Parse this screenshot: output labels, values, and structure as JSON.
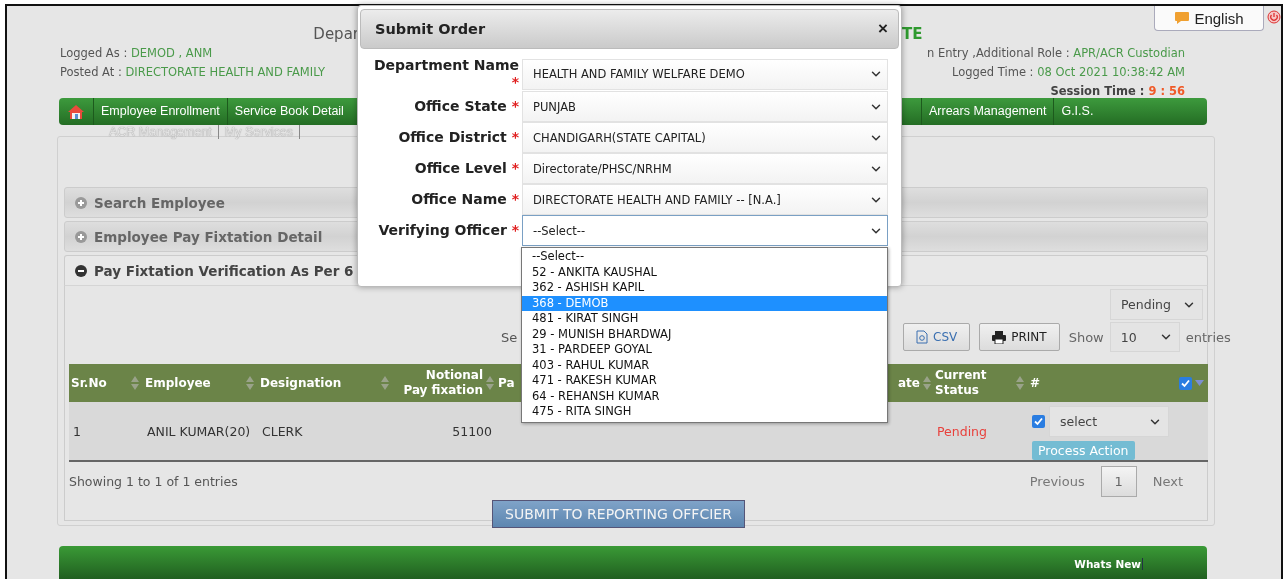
{
  "header": {
    "title_left": "Depar",
    "title_right": "TE",
    "language": "English",
    "left_lines": [
      {
        "label": "Logged As :",
        "value": "DEMOD , ANM"
      },
      {
        "label": "Posted At :",
        "value": "DIRECTORATE HEALTH AND FAMILY"
      }
    ],
    "right_lines": [
      {
        "label": "n Entry ,Additional Role :",
        "value": "APR/ACR Custodian",
        "kind": "info"
      },
      {
        "label": "Logged Time :",
        "value": "08 Oct 2021 10:38:42 AM",
        "kind": "info"
      },
      {
        "label": "Session Time :",
        "value": "9 : 56",
        "kind": "alert"
      }
    ]
  },
  "nav": {
    "left_items": [
      "Employee Enrollment",
      "Service Book Detail"
    ],
    "right_items": [
      "Arrears Management",
      "G.I.S."
    ],
    "sub_items": [
      "ACR Management",
      "My Services"
    ]
  },
  "sections": [
    {
      "title": "Search Employee",
      "expanded": false
    },
    {
      "title": "Employee Pay Fixtation Detail",
      "expanded": false
    },
    {
      "title": "Pay Fixtation Verification As Per 6",
      "expanded": true
    }
  ],
  "status_filter": "Pending",
  "search_label": "Se",
  "export_buttons": [
    {
      "label": "CSV",
      "kind": "csv"
    },
    {
      "label": "PRINT",
      "kind": "print"
    }
  ],
  "page_length": {
    "prefix": "Show",
    "value": "10",
    "suffix": "entries"
  },
  "table": {
    "columns": [
      {
        "label": "Sr.No",
        "sortable": true,
        "kind": "text"
      },
      {
        "label": "Employee",
        "sortable": true,
        "kind": "text"
      },
      {
        "label": "Designation",
        "sortable": true,
        "kind": "text"
      },
      {
        "label": "Notional\nPay fixation",
        "sortable": true,
        "kind": "number"
      },
      {
        "label": "Pa",
        "kind": "text"
      },
      {
        "label": "ate",
        "sortable": true,
        "kind": "number"
      },
      {
        "label": "Current\nStatus",
        "sortable": true,
        "kind": "text"
      },
      {
        "label": "#",
        "sortable": false,
        "kind": "text",
        "all_checked": true
      }
    ],
    "rows": [
      {
        "cells": [
          "1",
          "ANIL KUMAR(20)",
          "CLERK",
          "51100"
        ],
        "status": "Pending",
        "checked": true,
        "action": "select",
        "action_button": "Process Action"
      }
    ]
  },
  "info": "Showing 1 to 1 of 1 entries",
  "pagination": {
    "previous": "Previous",
    "pages": [
      {
        "label": "1",
        "selected": true
      }
    ],
    "next": "Next"
  },
  "submit_button": "SUBMIT TO REPORTING OFFCIER",
  "footer": {
    "label": "Whats New"
  },
  "modal": {
    "title": "Submit Order",
    "close": "×",
    "fields": [
      {
        "label": "Department Name",
        "mark": "*",
        "value": "HEALTH AND FAMILY WELFARE DEMO",
        "focused": false
      },
      {
        "label": "Office State",
        "mark": "*",
        "value": "PUNJAB",
        "focused": false
      },
      {
        "label": "Office District",
        "mark": "*",
        "value": "CHANDIGARH(STATE CAPITAL)",
        "focused": false
      },
      {
        "label": "Office Level",
        "mark": "*",
        "value": "Directorate/PHSC/NRHM",
        "focused": false
      },
      {
        "label": "Office Name",
        "mark": "*",
        "value": "DIRECTORATE HEALTH AND FAMILY -- [N.A.]",
        "focused": false
      },
      {
        "label": "Verifying Officer",
        "mark": "*",
        "value": "--Select--",
        "focused": true
      }
    ],
    "dropdown": {
      "options": [
        {
          "label": "--Select--",
          "selected": false
        },
        {
          "label": "52 - ANKITA KAUSHAL",
          "selected": false
        },
        {
          "label": "362 - ASHISH KAPIL",
          "selected": false
        },
        {
          "label": "368 - DEMOB",
          "selected": true
        },
        {
          "label": "481 - KIRAT SINGH",
          "selected": false
        },
        {
          "label": "29 - MUNISH BHARDWAJ",
          "selected": false
        },
        {
          "label": "31 - PARDEEP GOYAL",
          "selected": false
        },
        {
          "label": "403 - RAHUL KUMAR",
          "selected": false
        },
        {
          "label": "471 - RAKESH KUMAR",
          "selected": false
        },
        {
          "label": "64 - REHANSH KUMAR",
          "selected": false
        },
        {
          "label": "475 - RITA SINGH",
          "selected": false
        }
      ]
    }
  }
}
